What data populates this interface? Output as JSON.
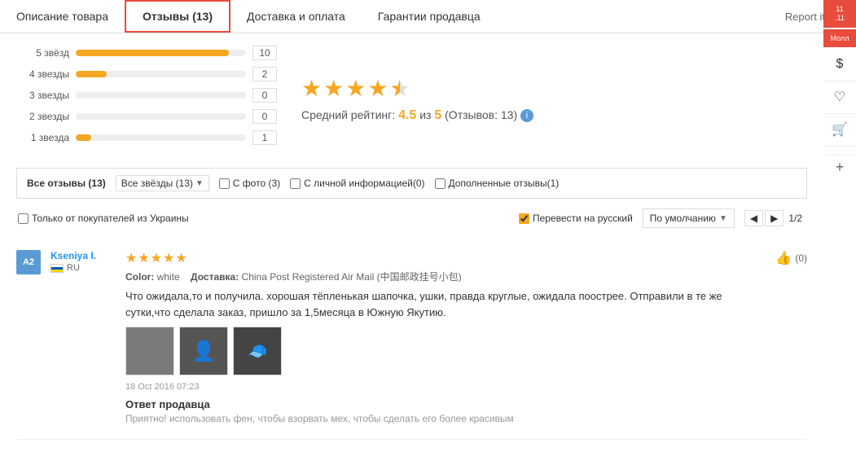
{
  "tabs": [
    {
      "id": "description",
      "label": "Описание товара",
      "active": false
    },
    {
      "id": "reviews",
      "label": "Отзывы (13)",
      "active": true
    },
    {
      "id": "delivery",
      "label": "Доставка и оплата",
      "active": false
    },
    {
      "id": "guarantee",
      "label": "Гарантии продавца",
      "active": false
    }
  ],
  "report_item": "Report item",
  "stars": {
    "five": {
      "label": "5 звёзд",
      "count": 10,
      "width": 90
    },
    "four": {
      "label": "4 звезды",
      "count": 2,
      "width": 18
    },
    "three": {
      "label": "3 звезды",
      "count": 0,
      "width": 0
    },
    "two": {
      "label": "2 звезды",
      "count": 0,
      "width": 0
    },
    "one": {
      "label": "1 звезда",
      "count": 1,
      "width": 9
    }
  },
  "rating": {
    "avg": "4.5",
    "of": "5",
    "label": "Средний рейтинг:",
    "reviews_label": "(Отзывов: 13)"
  },
  "filters": {
    "all_reviews": "Все отзывы (13)",
    "all_stars": "Все звёзды (13)",
    "with_photo": "С фото (3)",
    "personal_info": "С личной информацией(0)",
    "additional": "Дополненные отзывы(1)"
  },
  "options": {
    "ukraine_only": "Только от покупателей из Украины",
    "translate": "Перевести на русский",
    "sort_label": "По умолчанию",
    "page": "1/2"
  },
  "review": {
    "avatar": "A2",
    "name": "Kseniya I.",
    "flag": "RU",
    "stars": 5,
    "color_label": "Color:",
    "color_value": "white",
    "delivery_label": "Доставка:",
    "delivery_value": "China Post Registered Air Mail (中国邮政挂号小包)",
    "text": "Что ожидала,то и получила. хорошая тёпленькая шапочка, ушки, правда круглые, ожидала поострее. Отправили в те же сутки,что сделала заказ, пришло за 1,5месяца в Южную Якутию.",
    "date": "18 Oct 2016 07:23",
    "like_count": "(0)",
    "seller_response_title": "Ответ продавца",
    "seller_response_text": "Приятно! использовать фен, чтобы взорвать мех, чтобы сделать его более красивым"
  },
  "sidebar": {
    "promo_text": "11.11",
    "moall_text": "Молл",
    "icons": [
      "💲",
      "♡",
      "🛒",
      "📋"
    ]
  }
}
